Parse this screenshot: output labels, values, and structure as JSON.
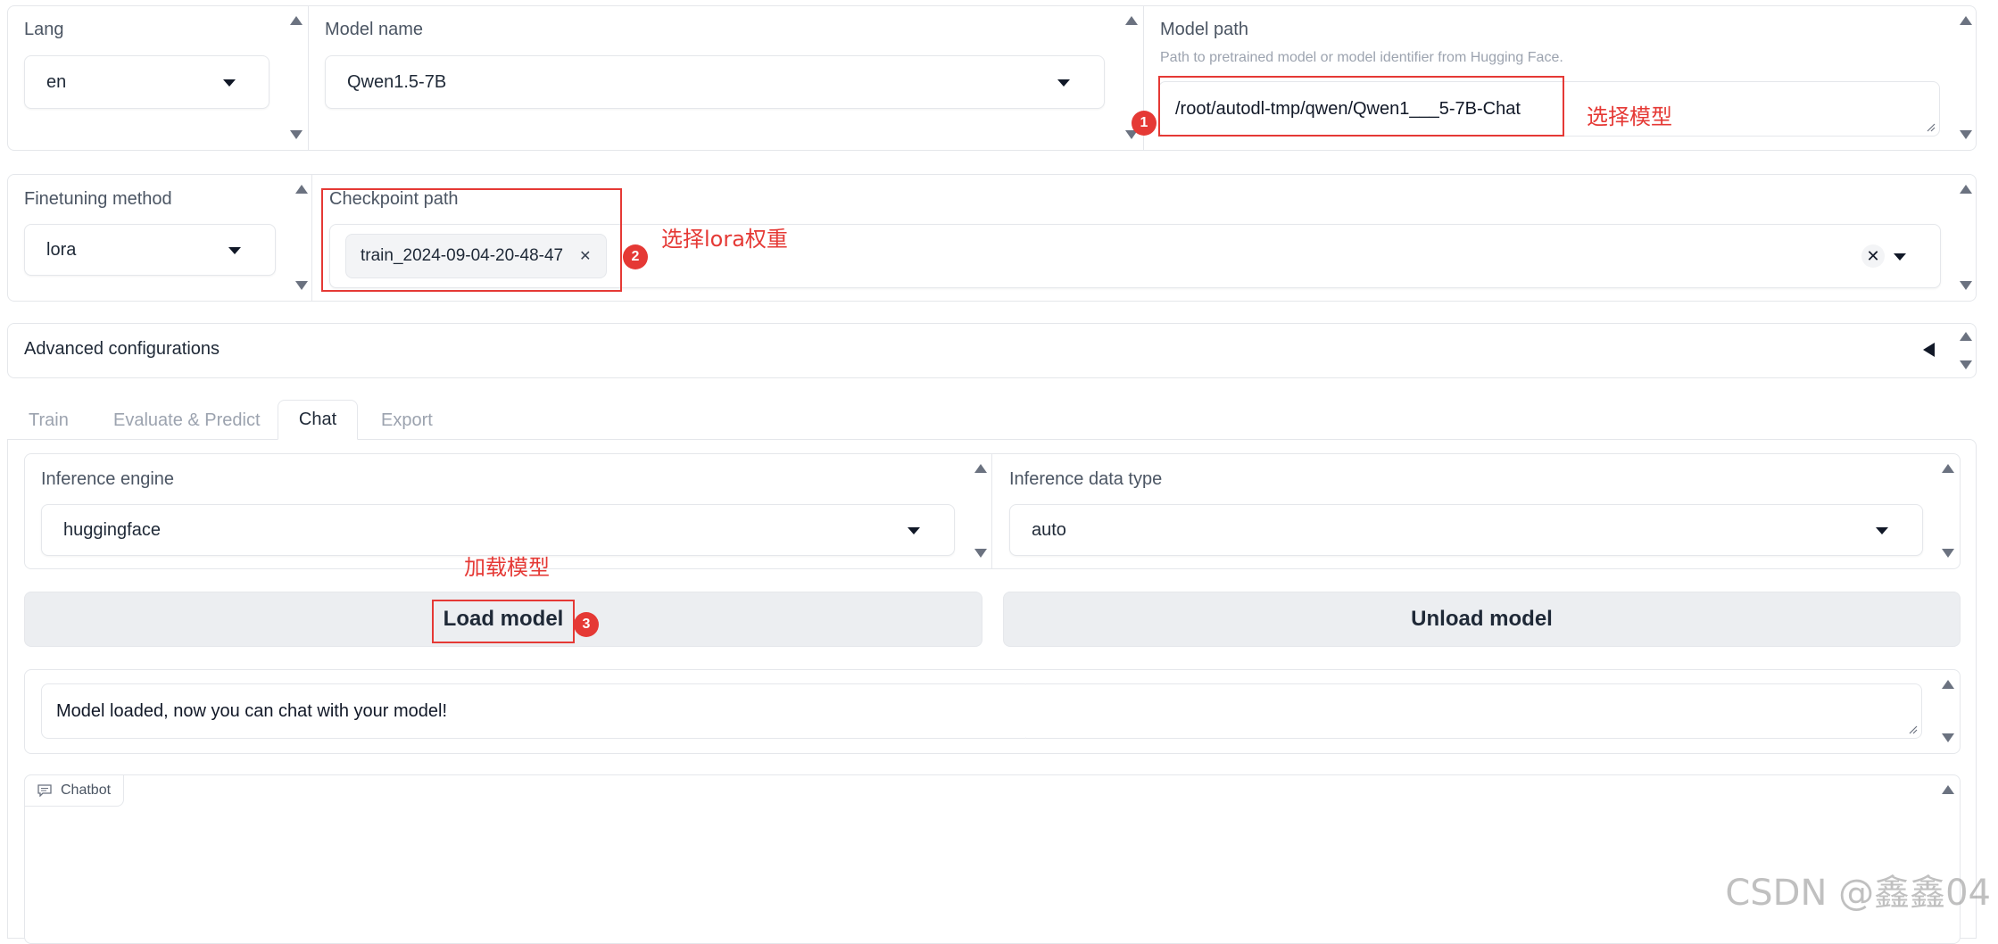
{
  "top_row": {
    "lang": {
      "label": "Lang",
      "value": "en"
    },
    "model_name": {
      "label": "Model name",
      "value": "Qwen1.5-7B"
    },
    "model_path": {
      "label": "Model path",
      "info": "Path to pretrained model or model identifier from Hugging Face.",
      "value": "/root/autodl-tmp/qwen/Qwen1___5-7B-Chat"
    }
  },
  "second_row": {
    "finetuning_method": {
      "label": "Finetuning method",
      "value": "lora"
    },
    "checkpoint_path": {
      "label": "Checkpoint path",
      "chips": [
        "train_2024-09-04-20-48-47"
      ]
    }
  },
  "advanced": {
    "label": "Advanced configurations"
  },
  "tabs": [
    {
      "label": "Train",
      "active": false
    },
    {
      "label": "Evaluate & Predict",
      "active": false
    },
    {
      "label": "Chat",
      "active": true
    },
    {
      "label": "Export",
      "active": false
    }
  ],
  "chat": {
    "inference_engine": {
      "label": "Inference engine",
      "value": "huggingface"
    },
    "inference_dtype": {
      "label": "Inference data type",
      "value": "auto"
    },
    "load_button": "Load model",
    "unload_button": "Unload model",
    "info_box": "Model loaded, now you can chat with your model!",
    "chatbot_label": "Chatbot"
  },
  "annotations": {
    "a1": {
      "badge": "1",
      "text": "选择模型"
    },
    "a2": {
      "badge": "2",
      "text": "选择lora权重"
    },
    "a3": {
      "badge": "3",
      "text": "加载模型"
    }
  },
  "watermark": "CSDN @鑫鑫04",
  "colors": {
    "annotation_red": "#e53935",
    "button_bg": "#eceef1",
    "border": "#e5e7eb"
  }
}
